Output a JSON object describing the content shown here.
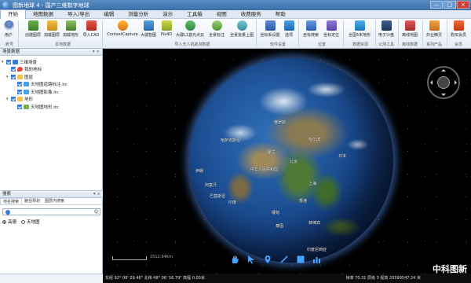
{
  "window": {
    "title": "图新地球 4 - 国产三维数字地球",
    "controls": [
      "—",
      "□",
      "×"
    ]
  },
  "menu": {
    "items": [
      "开始",
      "地图数据",
      "导入/导出",
      "编辑",
      "测量分析",
      "演示",
      "工具箱",
      "视图",
      "收费服务",
      "帮助"
    ],
    "active": "开始"
  },
  "ribbon": {
    "buttons": [
      "用户",
      "创建图层",
      "加载图层",
      "加载地形",
      "导入CAD",
      "ContextCapture",
      "大疆智图",
      "Pix4D",
      "大疆L1激光点云",
      "全景标注",
      "全景批量上图",
      "坐标系设置",
      "选项",
      "坐标搜索",
      "坐标定位",
      "全国5米地形",
      "电子沙盘",
      "离线地图",
      "外业精灵",
      "购买会员"
    ],
    "groups": [
      "账号",
      "本地数据",
      "导入无人机航测数据",
      "软件设置",
      "位置",
      "数据资源",
      "公测工具",
      "离线数据",
      "系列产品",
      "会员"
    ]
  },
  "layers": {
    "header": "场景数据",
    "items": [
      {
        "label": "三维场景",
        "level": 0
      },
      {
        "label": "我的地标",
        "level": 1
      },
      {
        "label": "图层",
        "level": 1
      },
      {
        "label": "天地图道路标注.lrc",
        "level": 2
      },
      {
        "label": "天地图影像.lrc",
        "level": 2
      },
      {
        "label": "地形",
        "level": 1
      },
      {
        "label": "天地图地形.lrc",
        "level": 2
      }
    ]
  },
  "search": {
    "header": "搜索",
    "tabs": [
      "地名搜索",
      "路径规划",
      "图层内搜索"
    ],
    "placeholder": "",
    "button": "Q",
    "options": [
      "高德",
      "天地图"
    ],
    "selected": "高德"
  },
  "globe_labels": [
    {
      "text": "俄罗斯"
    },
    {
      "text": "哈萨克斯坦"
    },
    {
      "text": "蒙古"
    },
    {
      "text": "中华人民共和国"
    },
    {
      "text": "印度"
    },
    {
      "text": "日本"
    },
    {
      "text": "菲律宾"
    },
    {
      "text": "缅甸"
    },
    {
      "text": "泰国"
    },
    {
      "text": "伊朗"
    },
    {
      "text": "阿富汗"
    },
    {
      "text": "巴基斯坦"
    },
    {
      "text": "印度尼西亚"
    },
    {
      "text": "哈尔滨"
    },
    {
      "text": "北京"
    },
    {
      "text": "上海"
    },
    {
      "text": "香港"
    }
  ],
  "scale": {
    "text": "1512.64Km"
  },
  "status": {
    "coords": "东经 92° 08' 29.46\"  北纬 48° 06' 56.79\"  高程 0.00米",
    "right": "帧率 70.31  层级 3  视高 20599547.24 米"
  },
  "watermark": "中科图新"
}
